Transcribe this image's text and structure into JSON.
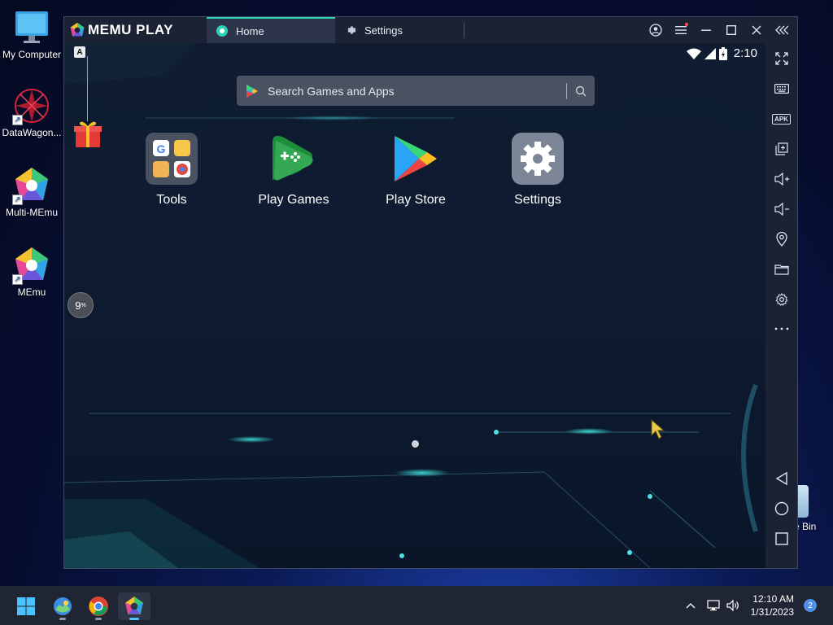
{
  "desktop": {
    "icons": [
      {
        "label": "My Computer"
      },
      {
        "label": "DataWagon..."
      },
      {
        "label": "Multi-MEmu"
      },
      {
        "label": "MEmu"
      }
    ],
    "recycle_label": "e Bin"
  },
  "emulator": {
    "brand": "MEMU PLAY",
    "tabs": [
      {
        "label": "Home",
        "icon": "home-app-icon",
        "active": true
      },
      {
        "label": "Settings",
        "icon": "gear-icon",
        "active": false
      }
    ],
    "title_controls": [
      "account-icon",
      "menu-icon",
      "minimize-icon",
      "maximize-icon",
      "close-icon",
      "collapse-icon"
    ],
    "status_bar": {
      "time": "2:10"
    },
    "search": {
      "placeholder": "Search Games and Apps"
    },
    "apps": [
      {
        "label": "Tools",
        "icon": "tools-folder-icon"
      },
      {
        "label": "Play Games",
        "icon": "play-games-icon"
      },
      {
        "label": "Play Store",
        "icon": "play-store-icon"
      },
      {
        "label": "Settings",
        "icon": "settings-icon"
      }
    ],
    "a_badge": "A",
    "cpu_percent": "9",
    "cpu_unit": "%",
    "toolbar": [
      "fullscreen-icon",
      "keyboard-icon",
      "apk-icon",
      "multi-window-icon",
      "volume-up-icon",
      "volume-down-icon",
      "location-icon",
      "folder-icon",
      "gear-icon",
      "more-icon",
      "back-icon",
      "home-icon",
      "recents-icon"
    ],
    "apk_label": "APK"
  },
  "taskbar": {
    "apps": [
      "start-icon",
      "photos-icon",
      "chrome-icon",
      "memu-icon"
    ],
    "time": "12:10 AM",
    "date": "1/31/2023",
    "notifications": "2"
  },
  "colors": {
    "accent": "#2ad1b4",
    "window_bg": "#0e1a2e",
    "titlebar_bg": "#1b2233",
    "taskbar_bg": "#1f2532"
  }
}
